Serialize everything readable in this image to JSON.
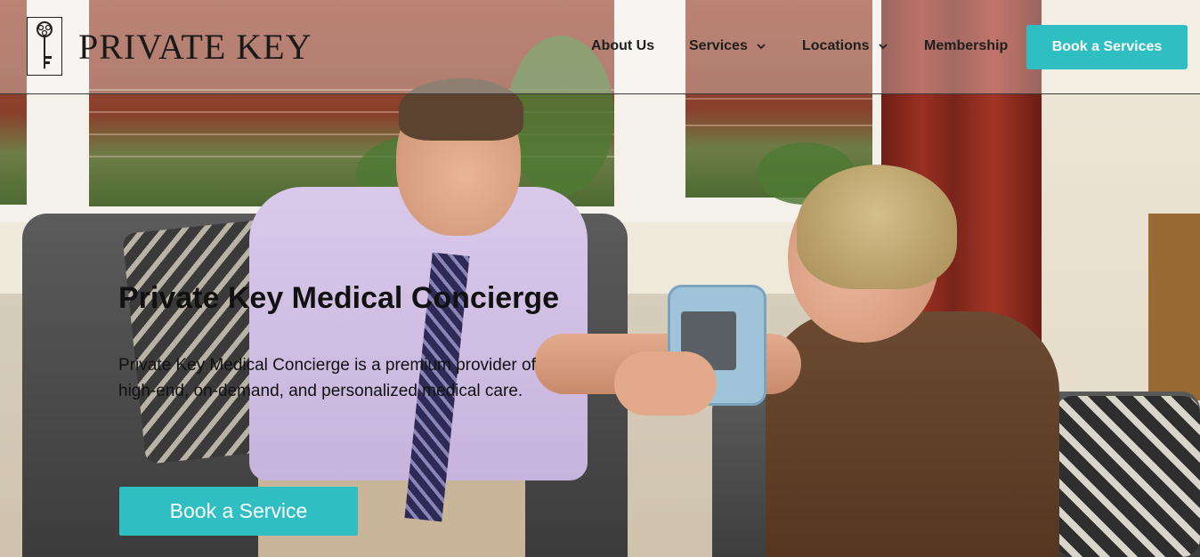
{
  "header": {
    "logo_text": "PRIVATE KEY",
    "logo_icon": "key-icon",
    "nav": [
      {
        "label": "About Us",
        "has_dropdown": false
      },
      {
        "label": "Services",
        "has_dropdown": true
      },
      {
        "label": "Locations",
        "has_dropdown": true
      },
      {
        "label": "Membership",
        "has_dropdown": false
      }
    ],
    "cta_label": "Book a Services"
  },
  "hero": {
    "title": "Private Key Medical Concierge",
    "description": "Private Key Medical Concierge is a premium provider of high-end, on-demand, and personalized medical care.",
    "cta_label": "Book a Service"
  },
  "colors": {
    "accent": "#2fbfc2",
    "text": "#111111",
    "button_text": "#ffffff"
  }
}
